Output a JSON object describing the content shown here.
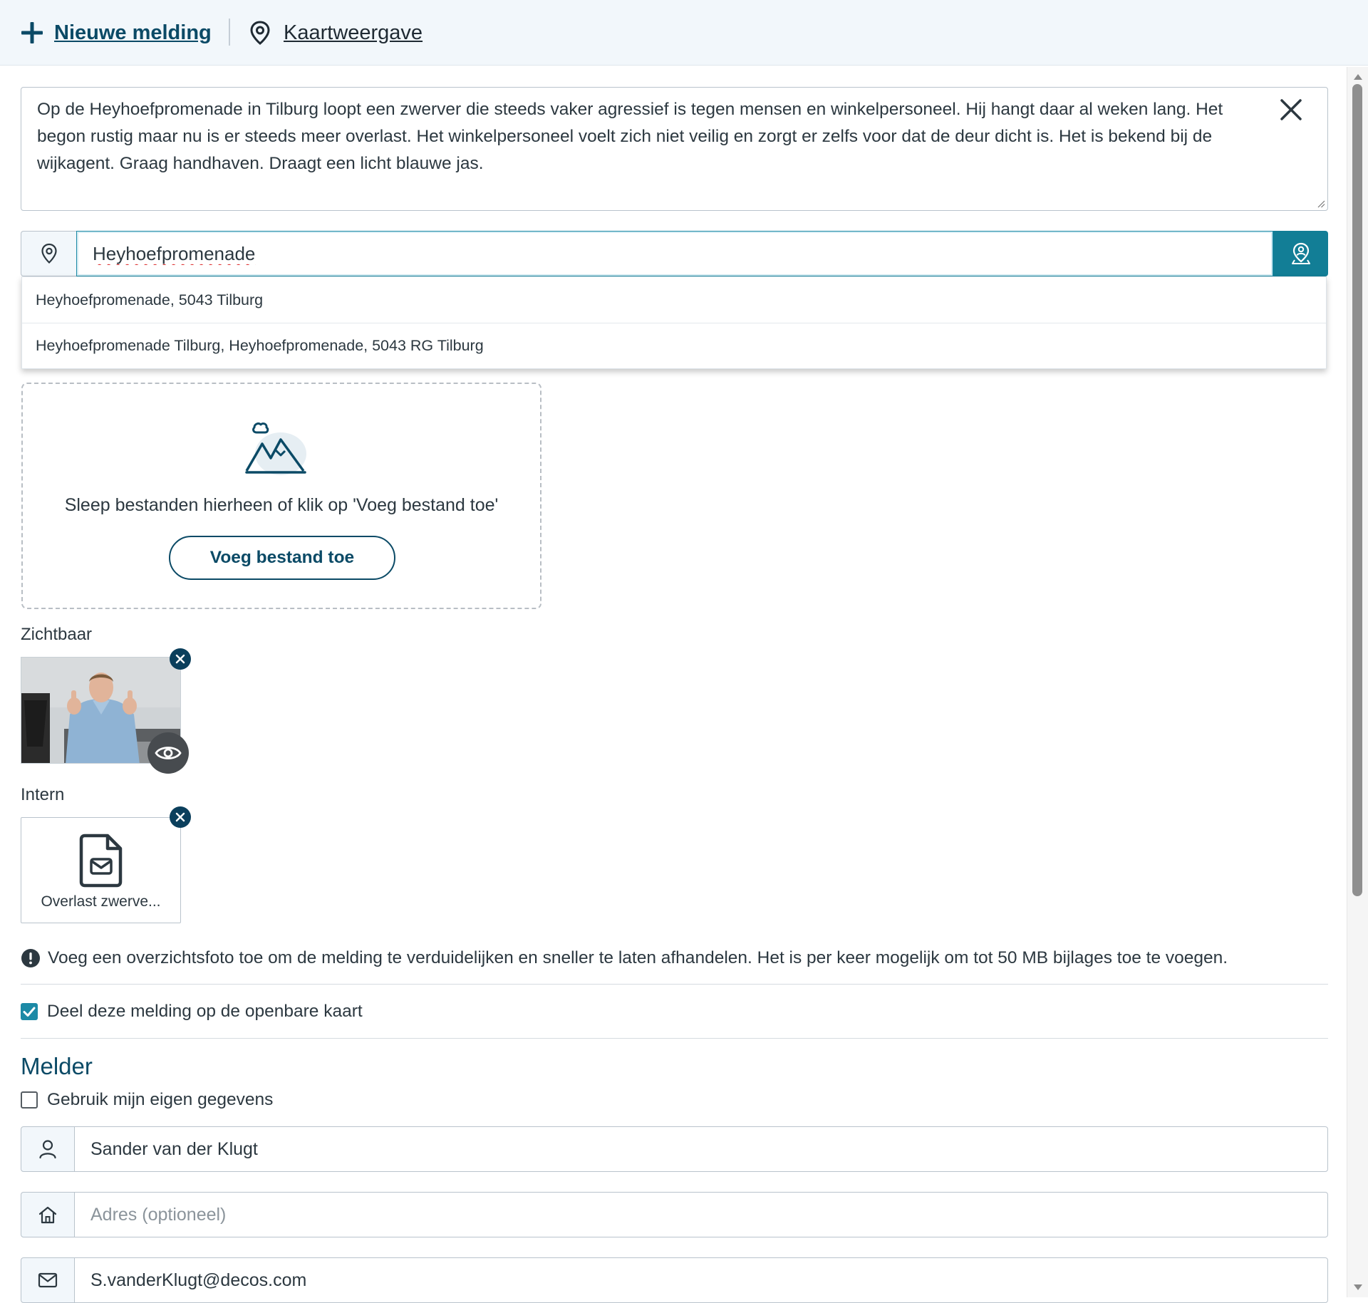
{
  "topbar": {
    "new_report_label": "Nieuwe melding",
    "map_view_label": "Kaartweergave"
  },
  "description": {
    "text": "Op de Heyhoefpromenade in Tilburg loopt een zwerver die steeds vaker agressief is tegen mensen en winkelpersoneel. Hij hangt daar al weken lang. Het begon rustig maar nu is er steeds meer overlast. Het winkelpersoneel voelt zich niet veilig en zorgt er zelfs voor dat de deur dicht is. Het is bekend bij de wijkagent. Graag handhaven. Draagt een licht blauwe jas."
  },
  "location": {
    "value": "Heyhoefpromenade",
    "suggestions": [
      "Heyhoefpromenade, 5043 Tilburg",
      "Heyhoefpromenade Tilburg, Heyhoefpromenade, 5043 RG Tilburg"
    ]
  },
  "dropzone": {
    "text": "Sleep bestanden hierheen of klik op 'Voeg bestand toe'",
    "button_label": "Voeg bestand toe"
  },
  "attachments": {
    "visible_label": "Zichtbaar",
    "internal_label": "Intern",
    "internal_file_name": "Overlast zwerve..."
  },
  "info_text": "Voeg een overzichtsfoto toe om de melding te verduidelijken en sneller te laten afhandelen. Het is per keer mogelijk om tot 50 MB bijlages toe te voegen.",
  "share_public": {
    "label": "Deel deze melding op de openbare kaart",
    "checked": true
  },
  "reporter": {
    "title": "Melder",
    "use_own_data_label": "Gebruik mijn eigen gegevens",
    "use_own_data_checked": false,
    "name_value": "Sander van der Klugt",
    "address_placeholder": "Adres (optioneel)",
    "email_value": "S.vanderKlugt@decos.com"
  },
  "colors": {
    "primary": "#0b4a66",
    "accent": "#127e96",
    "checkbox": "#1c8aa6"
  }
}
